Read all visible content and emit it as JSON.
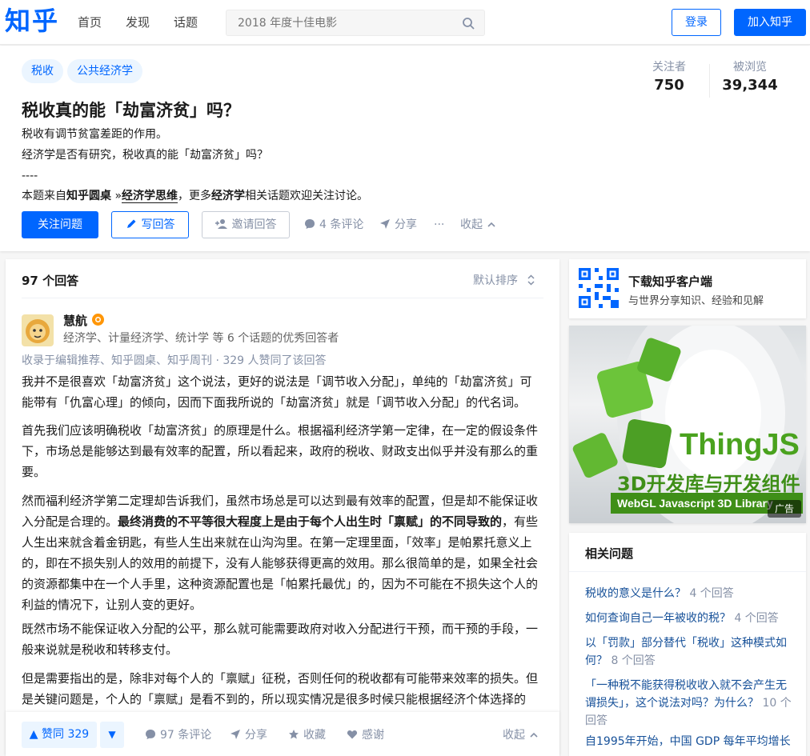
{
  "header": {
    "logo": "知乎",
    "nav": [
      "首页",
      "发现",
      "话题"
    ],
    "search_placeholder": "2018 年度十佳电影",
    "login": "登录",
    "join": "加入知乎"
  },
  "question": {
    "tags": [
      "税收",
      "公共经济学"
    ],
    "title": "税收真的能「劫富济贫」吗？",
    "detail_lines": [
      "税收有调节贫富差距的作用。",
      "经济学是否有研究，税收真的能「劫富济贫」吗？",
      "----"
    ],
    "source": {
      "prefix": "本题来自",
      "bold1": "知乎圆桌",
      "arrow": " »",
      "bold2": "经济学思维",
      "mid": "，更多",
      "bold3": "经济学",
      "suffix": "相关话题欢迎关注讨论。"
    },
    "stats": {
      "followers_label": "关注者",
      "followers": "750",
      "views_label": "被浏览",
      "views": "39,344"
    },
    "actions": {
      "follow": "关注问题",
      "write": "写回答",
      "invite": "邀请回答",
      "comments": "4 条评论",
      "share": "分享",
      "more": "···",
      "collapse": "收起"
    }
  },
  "answers": {
    "count": "97 个回答",
    "sort": "默认排序",
    "author": {
      "name": "慧航",
      "headline_prefix": "经济学、计量经济学、统计学 等 6 个话题的优秀回答者",
      "meta": "收录于编辑推荐、知乎圆桌、知乎周刊 · 329 人赞同了该回答"
    },
    "paragraphs": {
      "p1": "我并不是很喜欢「劫富济贫」这个说法，更好的说法是「调节收入分配」，单纯的「劫富济贫」可能带有「仇富心理」的倾向，因而下面我所说的「劫富济贫」就是「调节收入分配」的代名词。",
      "p2": "首先我们应该明确税收「劫富济贫」的原理是什么。根据福利经济学第一定律，在一定的假设条件下，市场总是能够达到最有效率的配置，所以看起来，政府的税收、财政支出似乎并没有那么的重要。",
      "p3a": "然而福利经济学第二定理却告诉我们，虽然市场总是可以达到最有效率的配置，但是却不能保证收入分配是合理的。",
      "p3b": "最终消费的不平等很大程度上是由于每个人出生时「禀赋」的不同导致的",
      "p3c": "，有些人生出来就含着金钥匙，有些人生出来就在山沟沟里。在第一定理里面，「效率」是帕累托意义上的，即在不损失别人的效用的前提下，没有人能够获得更高的效用。那么很简单的是，如果全社会的资源都集中在一个人手里，这种资源配置也是「帕累托最优」的，因为不可能在不损失这个人的利益的情况下，让别人变的更好。",
      "p4": "既然市场不能保证收入分配的公平，那么就可能需要政府对收入分配进行干预，而干预的手段，一般来说就是税收和转移支付。",
      "p5": "但是需要指出的是，除非对每个人的「禀赋」征税，否则任何的税收都有可能带来效率的损失。但是关键问题是，个人的「禀赋」是看不到的，所以现实情况是很多时候只能根据经济个体选择的「结果」进行征税，比如个人所得税、消费税等。特别是对产品价格有影响的税收，都将带来可能"
    },
    "footer": {
      "upvote": "▲ 赞同 329",
      "downvote": "▼",
      "comments": "97 条评论",
      "share": "分享",
      "collect": "收藏",
      "thanks": "感谢",
      "collapse": "收起"
    }
  },
  "sidebar": {
    "app_title": "下载知乎客户端",
    "app_sub": "与世界分享知识、经验和见解",
    "ad": {
      "brand": "ThingJS",
      "line2": "3D开发库与开发组件",
      "line3": "WebGL Javascript 3D Library",
      "badge": "广告"
    },
    "related_title": "相关问题",
    "related": [
      {
        "q": "税收的意义是什么？",
        "count": "4 个回答"
      },
      {
        "q": "如何查询自己一年被收的税？",
        "count": "4 个回答"
      },
      {
        "q": "以「罚款」部分替代「税收」这种模式如何？",
        "count": "8 个回答"
      },
      {
        "q": "「一种税不能获得税收收入就不会产生无谓损失」，这个说法对吗？为什么？",
        "count": "10 个回答"
      },
      {
        "q": "自1995年开始，中国 GDP 每年平均增长",
        "count": ""
      }
    ]
  },
  "colors": {
    "brand": "#0066ff",
    "link": "#175199",
    "muted": "#8590a6"
  }
}
